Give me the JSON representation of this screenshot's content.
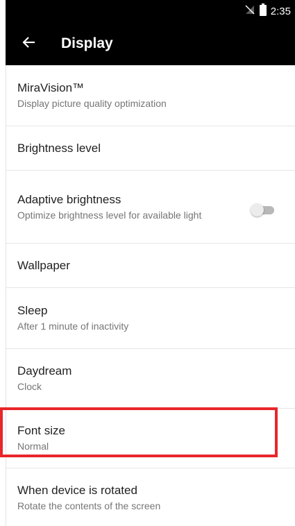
{
  "status_bar": {
    "time": "2:35",
    "icons": [
      "no-sim-icon",
      "battery-icon"
    ]
  },
  "app_bar": {
    "title": "Display",
    "back_icon": "arrow-back-icon"
  },
  "settings": {
    "items": [
      {
        "title": "MiraVision™",
        "summary": "Display picture quality optimization"
      },
      {
        "title": "Brightness level"
      },
      {
        "title": "Adaptive brightness",
        "summary": "Optimize brightness level for available light",
        "toggle": "off"
      },
      {
        "title": "Wallpaper"
      },
      {
        "title": "Sleep",
        "summary": "After 1 minute of inactivity"
      },
      {
        "title": "Daydream",
        "summary": "Clock"
      },
      {
        "title": "Font size",
        "summary": "Normal"
      },
      {
        "title": "When device is rotated",
        "summary": "Rotate the contents of the screen"
      }
    ]
  },
  "colors": {
    "app_bar_bg": "#000000",
    "highlight": "#e8262b",
    "title_text": "#1f1f1f",
    "summary_text": "#757575"
  }
}
